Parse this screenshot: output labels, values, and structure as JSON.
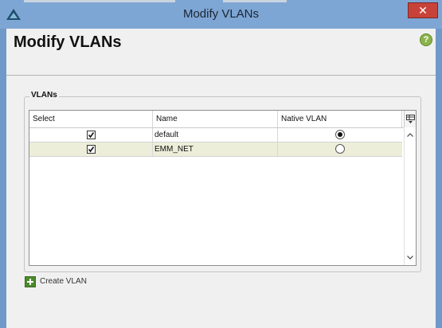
{
  "window": {
    "title": "Modify VLANs",
    "close_glyph": "✕"
  },
  "header": {
    "title": "Modify VLANs",
    "help_glyph": "?"
  },
  "vlans_group": {
    "legend": "VLANs",
    "columns": [
      "Select",
      "Name",
      "Native VLAN"
    ],
    "rows": [
      {
        "selected": true,
        "name": "default",
        "native": true
      },
      {
        "selected": true,
        "name": "EMM_NET",
        "native": false
      }
    ]
  },
  "actions": {
    "create_vlan_label": "Create VLAN"
  },
  "icons": {
    "app": "app-triangle-icon",
    "close": "close-icon",
    "help": "help-icon",
    "column_chooser": "column-chooser-icon",
    "create": "plus-icon"
  },
  "colors": {
    "row_alt": "#edeed9",
    "accent_green": "#4c8a2a",
    "close_red": "#c7433a"
  }
}
